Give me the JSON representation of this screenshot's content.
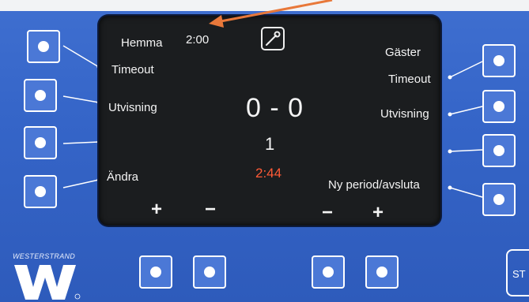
{
  "home": {
    "team_label": "Hemma",
    "timeout_label": "Timeout",
    "penalty_label": "Utvisning",
    "edit_label": "Ändra"
  },
  "away": {
    "team_label": "Gäster",
    "timeout_label": "Timeout",
    "penalty_label": "Utvisning",
    "next_period_label": "Ny period/avsluta"
  },
  "timeout_time": "2:00",
  "score": "0 - 0",
  "period": "1",
  "game_clock": "2:44",
  "adjust": {
    "plus_left": "+",
    "minus_left": "−",
    "minus_right": "−",
    "plus_right": "+"
  },
  "brand": "WESTERSTRAND",
  "start_label": "ST",
  "icons": {
    "settings": "wrench-icon",
    "annotation": "arrow-icon"
  },
  "colors": {
    "panel": "#3565c8",
    "screen": "#1b1d1f",
    "clock": "#ff5a36",
    "annotation_arrow": "#e8783a"
  }
}
